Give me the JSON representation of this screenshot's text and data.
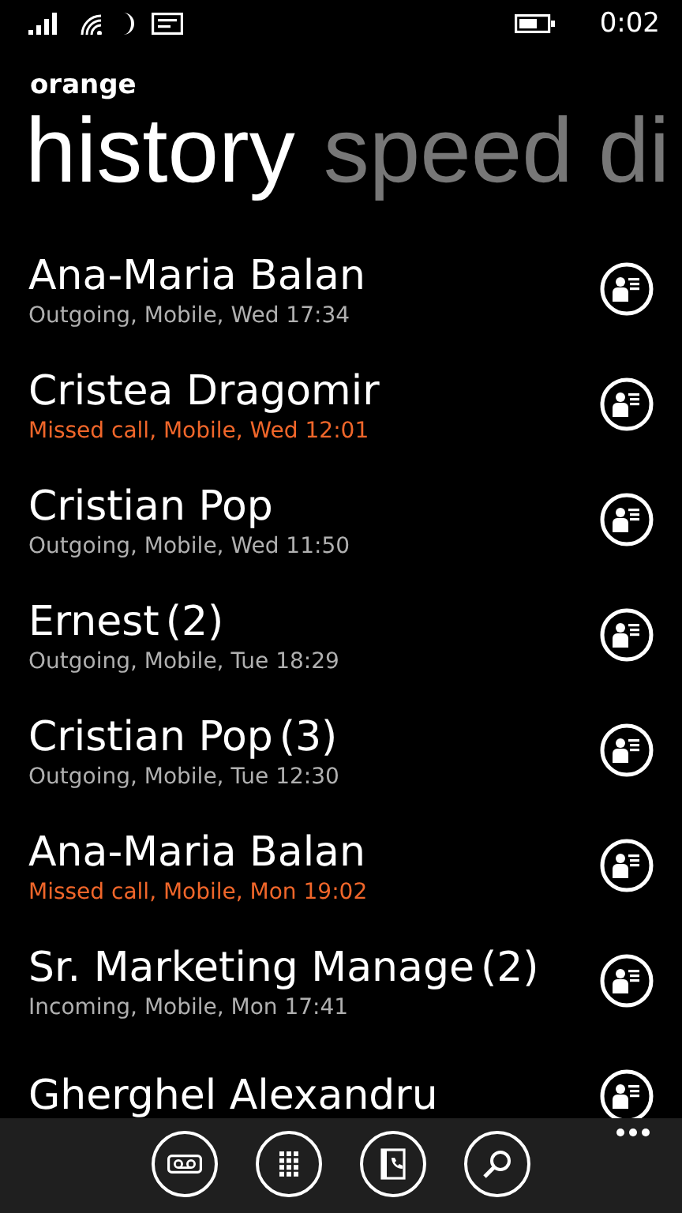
{
  "status_bar": {
    "time": "0:02"
  },
  "app_title": "orange",
  "pivot": [
    {
      "label": "history",
      "selected": true
    },
    {
      "label": "speed di",
      "selected": false
    }
  ],
  "calls": [
    {
      "name": "Ana-Maria Balan",
      "details": "Outgoing, Mobile, Wed 17:34",
      "missed": false
    },
    {
      "name": "Cristea Dragomir",
      "details": "Missed call, Mobile, Wed 12:01",
      "missed": true
    },
    {
      "name": "Cristian Pop",
      "details": "Outgoing, Mobile, Wed 11:50",
      "missed": false
    },
    {
      "name": "Ernest",
      "count": "(2)",
      "details": "Outgoing, Mobile, Tue 18:29",
      "missed": false
    },
    {
      "name": "Cristian Pop",
      "count": "(3)",
      "details": "Outgoing, Mobile, Tue 12:30",
      "missed": false
    },
    {
      "name": "Ana-Maria Balan",
      "details": "Missed call, Mobile, Mon 19:02",
      "missed": true
    },
    {
      "name": "Sr. Marketing Manage",
      "count": "(2)",
      "details": "Incoming, Mobile, Mon 17:41",
      "missed": false
    },
    {
      "name": "Gherghel Alexandru"
    }
  ]
}
